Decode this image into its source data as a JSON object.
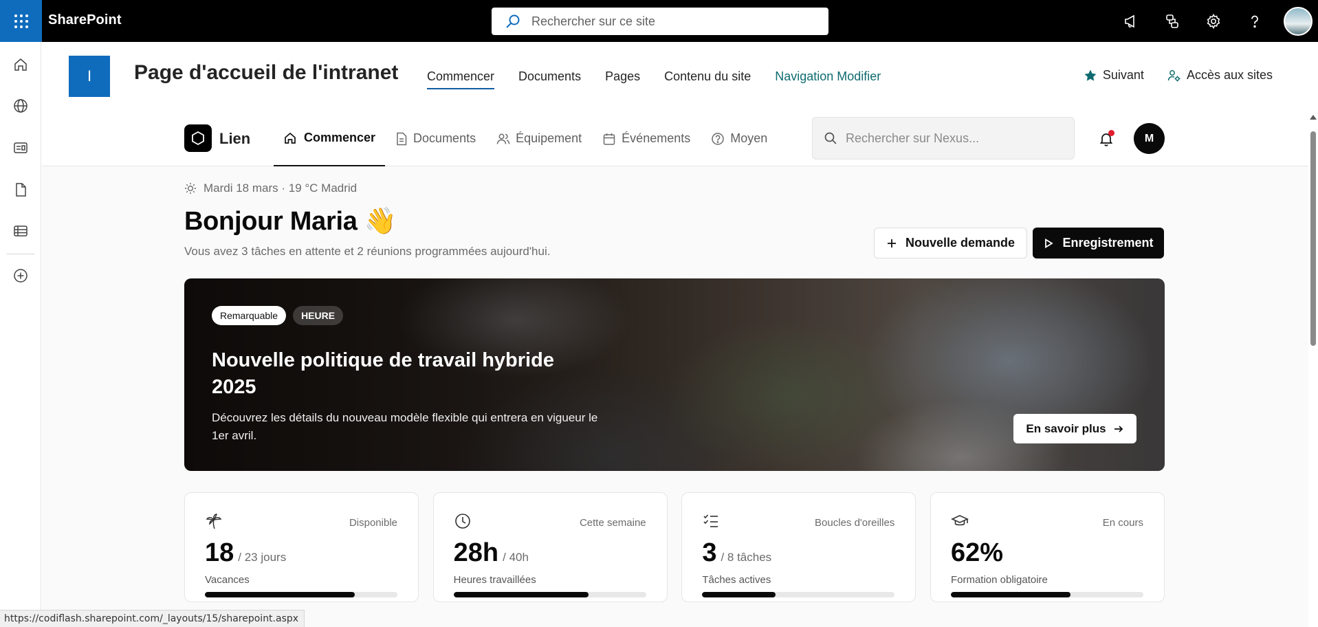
{
  "suite": {
    "brand": "SharePoint",
    "search_placeholder": "Rechercher sur ce site"
  },
  "site": {
    "logo_letter": "I",
    "title": "Page d'accueil de l'intranet",
    "nav": [
      "Commencer",
      "Documents",
      "Pages",
      "Contenu du site"
    ],
    "nav_edit": "Navigation Modifier",
    "follow_label": "Suivant",
    "sites_label": "Accès aux sites"
  },
  "app": {
    "name": "Lien",
    "tabs": [
      "Commencer",
      "Documents",
      "Équipement",
      "Événements",
      "Moyen"
    ],
    "search_placeholder": "Rechercher sur Nexus...",
    "avatar_initial": "M"
  },
  "content": {
    "dateline": "Mardi 18 mars · 19 °C Madrid",
    "greeting": "Bonjour Maria 👋",
    "subline": "Vous avez 3 tâches en attente et 2 réunions programmées aujourd'hui.",
    "btn_new": "Nouvelle demande",
    "btn_record": "Enregistrement"
  },
  "hero": {
    "badge_primary": "Remarquable",
    "badge_secondary": "HEURE",
    "title": "Nouvelle politique de travail hybride 2025",
    "description": "Découvrez les détails du nouveau modèle flexible qui entrera en vigueur le 1er avril.",
    "cta": "En savoir plus"
  },
  "stats": [
    {
      "icon": "palm-tree-icon",
      "tag": "Disponible",
      "value": "18",
      "suffix": "/ 23 jours",
      "label": "Vacances",
      "progress": 0.78
    },
    {
      "icon": "clock-icon",
      "tag": "Cette semaine",
      "value": "28h",
      "suffix": "/ 40h",
      "label": "Heures travaillées",
      "progress": 0.7
    },
    {
      "icon": "checklist-icon",
      "tag": "Boucles d'oreilles",
      "value": "3",
      "suffix": "/ 8 tâches",
      "label": "Tâches actives",
      "progress": 0.38
    },
    {
      "icon": "graduation-cap-icon",
      "tag": "En cours",
      "value": "62%",
      "suffix": "",
      "label": "Formation obligatoire",
      "progress": 0.62
    }
  ],
  "status_url": "https://codiflash.sharepoint.com/_layouts/15/sharepoint.aspx",
  "colors": {
    "suite_blue": "#0f6cbd",
    "teal_link": "#0f6b6f",
    "notification_red": "#e11d2e"
  }
}
